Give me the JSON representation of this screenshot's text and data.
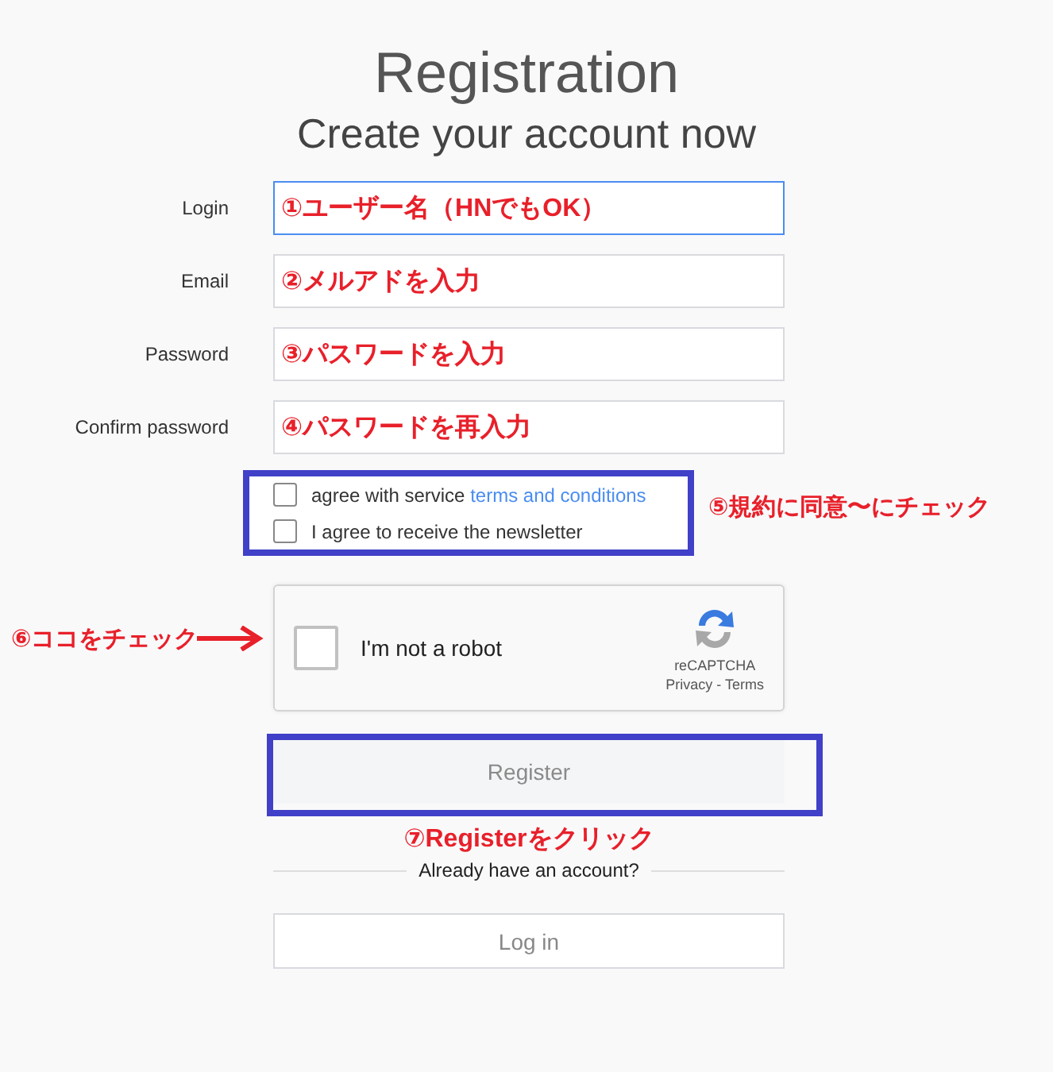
{
  "header": {
    "title": "Registration",
    "subtitle": "Create your account now"
  },
  "fields": [
    {
      "label": "Login",
      "annotation": "①ユーザー名（HNでもOK）",
      "focused": true
    },
    {
      "label": "Email",
      "annotation": "②メルアドを入力",
      "focused": false
    },
    {
      "label": "Password",
      "annotation": "③パスワードを入力",
      "focused": false
    },
    {
      "label": "Confirm password",
      "annotation": "④パスワードを再入力",
      "focused": false
    }
  ],
  "options": [
    {
      "label": "agree with service",
      "link": "terms and conditions",
      "checked": false
    },
    {
      "label": "I agree to receive the newsletter",
      "checked": false
    }
  ],
  "options_note": "⑤規約に同意〜にチェック",
  "captcha": {
    "label": "I'm not a robot",
    "checked": false,
    "brand": "reCAPTCHA",
    "links": "Privacy - Terms",
    "note": "⑥ココをチェック"
  },
  "register": {
    "label": "Register",
    "disabled": true,
    "note": "⑦Registerをクリック"
  },
  "divider": "Already have an account?",
  "login_button": "Log in"
}
